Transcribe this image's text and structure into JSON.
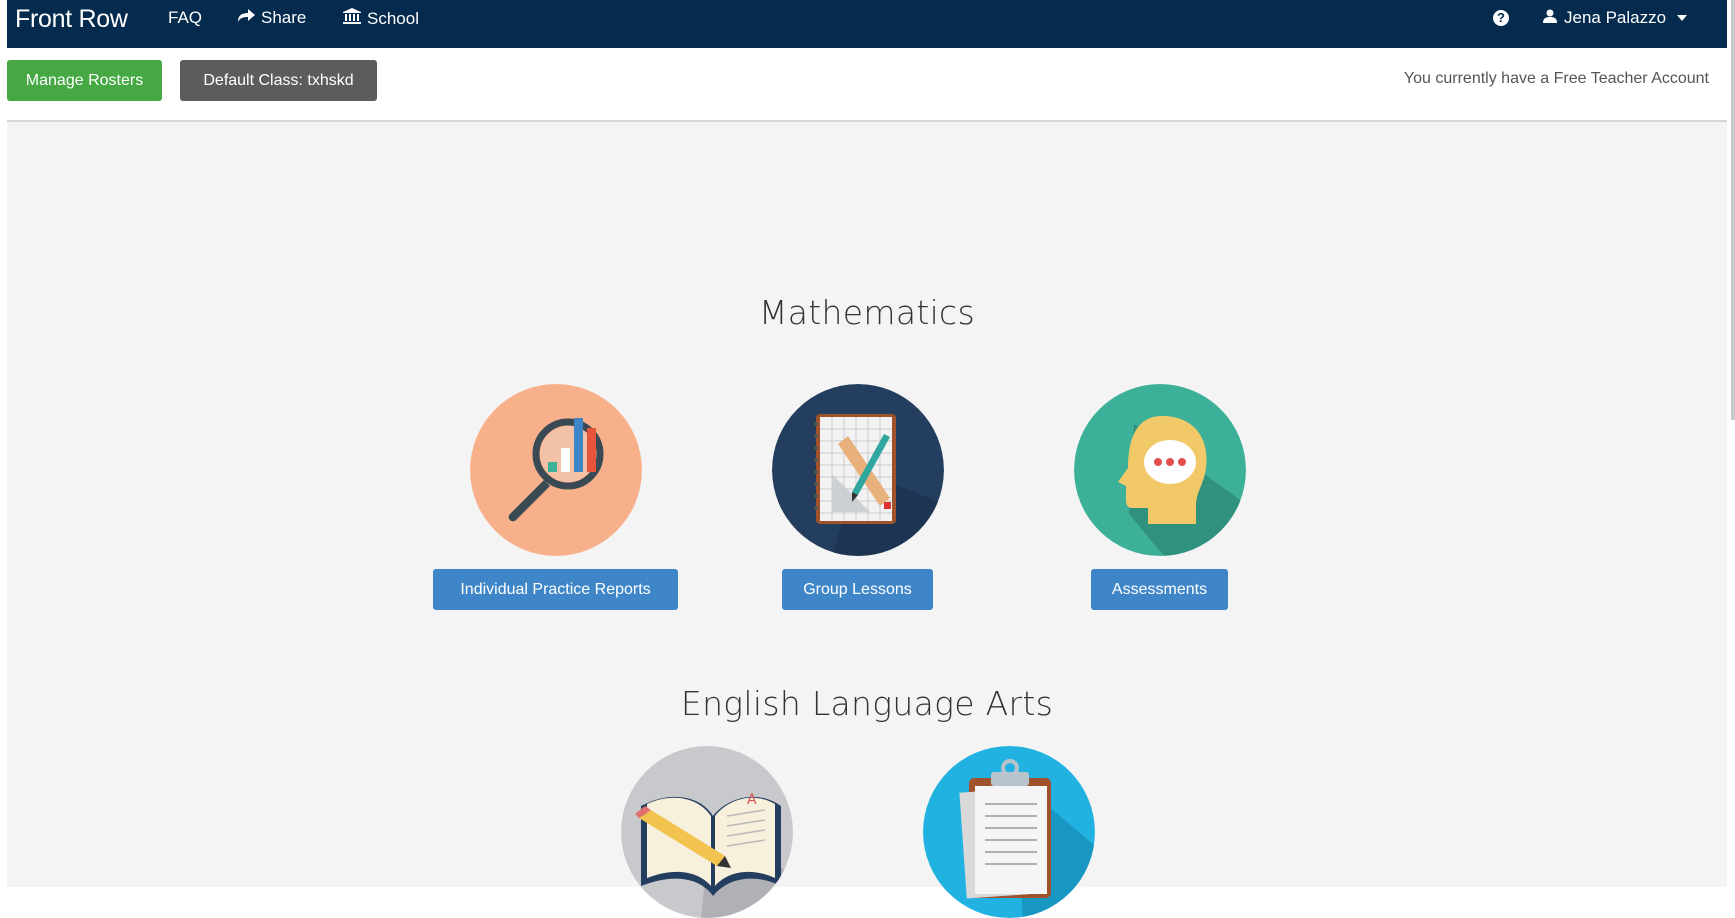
{
  "navbar": {
    "brand": "Front Row",
    "faq": "FAQ",
    "share": "Share",
    "school": "School",
    "help_icon": "question-circle-icon",
    "user_name": "Jena Palazzo"
  },
  "subbar": {
    "manage_rosters": "Manage Rosters",
    "default_class": "Default Class: txhskd",
    "account_status": "You currently have a Free Teacher Account"
  },
  "mathematics": {
    "title": "Mathematics",
    "tiles": [
      {
        "label": "Individual Practice Reports",
        "icon": "report-magnifier-icon",
        "color": "#f8b08a"
      },
      {
        "label": "Group Lessons",
        "icon": "notebook-ruler-icon",
        "color": "#243e5f"
      },
      {
        "label": "Assessments",
        "icon": "head-thought-icon",
        "color": "#3db09a"
      }
    ]
  },
  "ela": {
    "title": "English Language Arts",
    "tiles": [
      {
        "icon": "open-book-pencil-icon",
        "color": "#c7c9cd"
      },
      {
        "icon": "clipboard-icon",
        "color": "#22b2e2"
      }
    ]
  },
  "colors": {
    "navbar": "#042a4d",
    "primary_button": "#3f86c8",
    "green_button": "#45a843",
    "gray_button": "#5c5c5c",
    "page_background": "#f4f4f4"
  }
}
